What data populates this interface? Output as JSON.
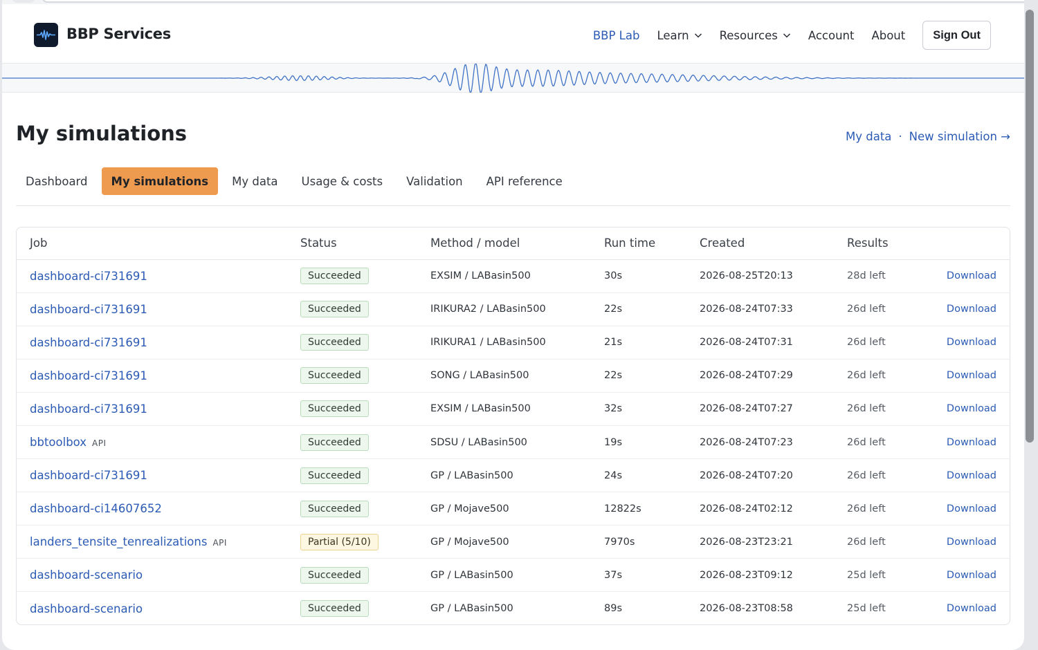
{
  "header": {
    "brand": "BBP Services",
    "nav": [
      {
        "label": "BBP Lab",
        "active": true,
        "dropdown": false
      },
      {
        "label": "Learn",
        "active": false,
        "dropdown": true
      },
      {
        "label": "Resources",
        "active": false,
        "dropdown": true
      },
      {
        "label": "Account",
        "active": false,
        "dropdown": false
      },
      {
        "label": "About",
        "active": false,
        "dropdown": false
      }
    ],
    "sign_out_label": "Sign Out"
  },
  "page": {
    "title": "My simulations",
    "link_my_data": "My data",
    "link_separator": "·",
    "link_new_simulation": "New simulation →"
  },
  "tabs": [
    {
      "label": "Dashboard",
      "active": false
    },
    {
      "label": "My simulations",
      "active": true
    },
    {
      "label": "My data",
      "active": false
    },
    {
      "label": "Usage & costs",
      "active": false
    },
    {
      "label": "Validation",
      "active": false
    },
    {
      "label": "API reference",
      "active": false
    }
  ],
  "table": {
    "columns": [
      "Job",
      "Status",
      "Method / model",
      "Run time",
      "Created",
      "Results"
    ],
    "download_label": "Download",
    "rows": [
      {
        "job": "dashboard-ci731691",
        "api": "",
        "status": "Succeeded",
        "status_kind": "success",
        "method": "EXSIM / LABasin500",
        "run_time": "30s",
        "created": "2026-08-25T20:13",
        "results": "28d left"
      },
      {
        "job": "dashboard-ci731691",
        "api": "",
        "status": "Succeeded",
        "status_kind": "success",
        "method": "IRIKURA2 / LABasin500",
        "run_time": "22s",
        "created": "2026-08-24T07:33",
        "results": "26d left"
      },
      {
        "job": "dashboard-ci731691",
        "api": "",
        "status": "Succeeded",
        "status_kind": "success",
        "method": "IRIKURA1 / LABasin500",
        "run_time": "21s",
        "created": "2026-08-24T07:31",
        "results": "26d left"
      },
      {
        "job": "dashboard-ci731691",
        "api": "",
        "status": "Succeeded",
        "status_kind": "success",
        "method": "SONG / LABasin500",
        "run_time": "22s",
        "created": "2026-08-24T07:29",
        "results": "26d left"
      },
      {
        "job": "dashboard-ci731691",
        "api": "",
        "status": "Succeeded",
        "status_kind": "success",
        "method": "EXSIM / LABasin500",
        "run_time": "32s",
        "created": "2026-08-24T07:27",
        "results": "26d left"
      },
      {
        "job": "bbtoolbox",
        "api": "API",
        "status": "Succeeded",
        "status_kind": "success",
        "method": "SDSU / LABasin500",
        "run_time": "19s",
        "created": "2026-08-24T07:23",
        "results": "26d left"
      },
      {
        "job": "dashboard-ci731691",
        "api": "",
        "status": "Succeeded",
        "status_kind": "success",
        "method": "GP / LABasin500",
        "run_time": "24s",
        "created": "2026-08-24T07:20",
        "results": "26d left"
      },
      {
        "job": "dashboard-ci14607652",
        "api": "",
        "status": "Succeeded",
        "status_kind": "success",
        "method": "GP / Mojave500",
        "run_time": "12822s",
        "created": "2026-08-24T02:12",
        "results": "26d left"
      },
      {
        "job": "landers_tensite_tenrealizations",
        "api": "API",
        "status": "Partial (5/10)",
        "status_kind": "partial",
        "method": "GP / Mojave500",
        "run_time": "7970s",
        "created": "2026-08-23T23:21",
        "results": "26d left"
      },
      {
        "job": "dashboard-scenario",
        "api": "",
        "status": "Succeeded",
        "status_kind": "success",
        "method": "GP / LABasin500",
        "run_time": "37s",
        "created": "2026-08-23T09:12",
        "results": "25d left"
      },
      {
        "job": "dashboard-scenario",
        "api": "",
        "status": "Succeeded",
        "status_kind": "success",
        "method": "GP / LABasin500",
        "run_time": "89s",
        "created": "2026-08-23T08:58",
        "results": "25d left"
      }
    ]
  },
  "colors": {
    "accent": "#2c5bb5",
    "active_tab": "#ee9a4f",
    "success_bg": "#eef7ee",
    "partial_bg": "#fdf6e0"
  }
}
